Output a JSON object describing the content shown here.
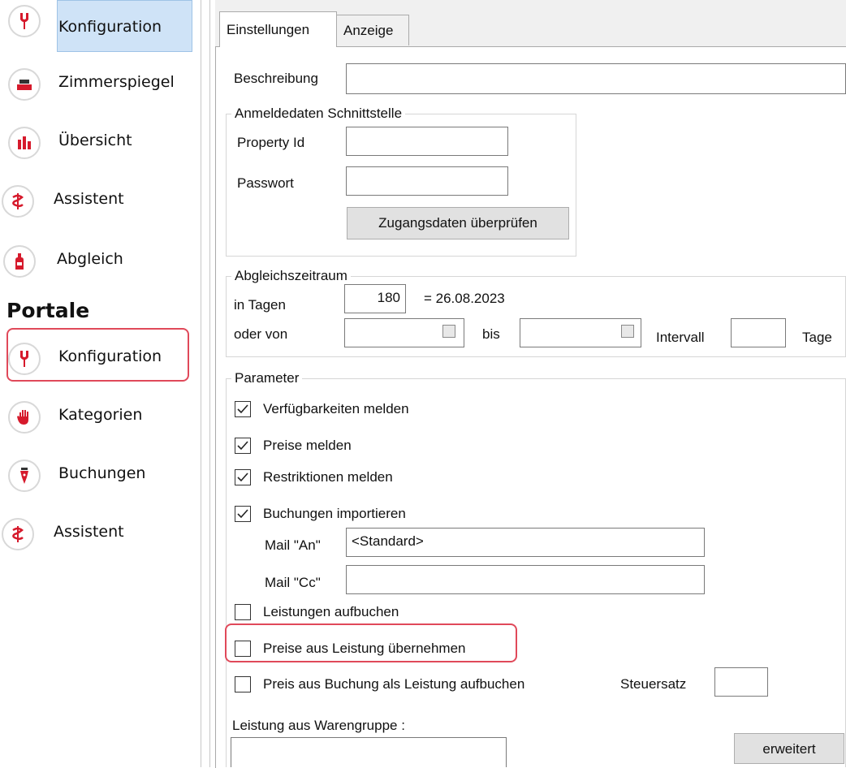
{
  "sidebar": {
    "top_items": [
      {
        "label": "Konfiguration",
        "icon": "wrench-icon"
      },
      {
        "label": "Zimmerspiegel",
        "icon": "bed-icon"
      },
      {
        "label": "Übersicht",
        "icon": "bar-chart-icon"
      },
      {
        "label": "Assistent",
        "icon": "assistant-icon"
      },
      {
        "label": "Abgleich",
        "icon": "bottle-icon"
      }
    ],
    "section_title": "Portale",
    "portale_items": [
      {
        "label": "Konfiguration",
        "icon": "wrench-icon"
      },
      {
        "label": "Kategorien",
        "icon": "hand-icon"
      },
      {
        "label": "Buchungen",
        "icon": "pen-nib-icon"
      },
      {
        "label": "Assistent",
        "icon": "assistant-icon"
      }
    ]
  },
  "tabs": [
    "Einstellungen",
    "Anzeige"
  ],
  "form": {
    "beschreibung_label": "Beschreibung",
    "beschreibung_value": "",
    "anmelde_group": "Anmeldedaten Schnittstelle",
    "property_label": "Property Id",
    "property_value": "",
    "passwort_label": "Passwort",
    "passwort_value": "",
    "check_button": "Zugangsdaten überprüfen",
    "abgleich_group": "Abgleichszeitraum",
    "in_tagen_label": "in Tagen",
    "in_tagen_value": "180",
    "date_result": "= 26.08.2023",
    "oder_von_label": "oder von",
    "bis_label": "bis",
    "intervall_label": "Intervall",
    "tage_label": "Tage",
    "parameter_group": "Parameter",
    "checkboxes": [
      {
        "label": "Verfügbarkeiten melden",
        "checked": true
      },
      {
        "label": "Preise melden",
        "checked": true
      },
      {
        "label": "Restriktionen melden",
        "checked": true
      },
      {
        "label": "Buchungen importieren",
        "checked": true
      },
      {
        "label": "Leistungen aufbuchen",
        "checked": false
      },
      {
        "label": "Preise aus Leistung übernehmen",
        "checked": false
      },
      {
        "label": "Preis aus Buchung als Leistung aufbuchen",
        "checked": false
      }
    ],
    "mail_an_label": "Mail \"An\"",
    "mail_an_value": "<Standard>",
    "mail_cc_label": "Mail \"Cc\"",
    "mail_cc_value": "",
    "steuersatz_label": "Steuersatz",
    "warengruppe_label": "Leistung aus Warengruppe  :",
    "erweitert_button": "erweitert"
  },
  "colors": {
    "accent_red": "#d61a2c",
    "highlight": "#e0495a",
    "active_bg": "#cfe3f7"
  }
}
